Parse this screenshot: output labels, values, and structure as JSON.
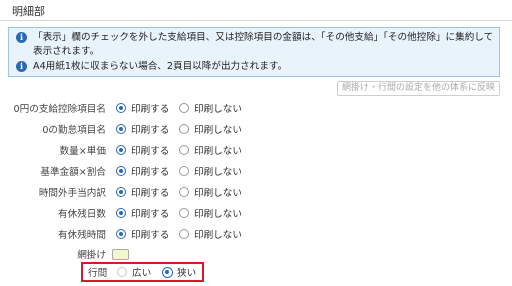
{
  "section": {
    "title": "明細部"
  },
  "info": {
    "line1": "「表示」欄のチェックを外した支給項目、又は控除項目の金額は、「その他支給」「その他控除」に集約して表示されます。",
    "line2": "A4用紙1枚に収まらない場合、2頁目以降が出力されます。",
    "icon": "info-icon"
  },
  "reflect_button": {
    "label": "網掛け・行間の設定を他の体系に反映"
  },
  "options": {
    "print": "印刷する",
    "no_print": "印刷しない"
  },
  "rows": [
    {
      "label": "0円の支給控除項目名",
      "selected": "print"
    },
    {
      "label": "0の勤怠項目名",
      "selected": "print"
    },
    {
      "label": "数量×単価",
      "selected": "print"
    },
    {
      "label": "基準金額×割合",
      "selected": "print"
    },
    {
      "label": "時間外手当内訳",
      "selected": "print"
    },
    {
      "label": "有休残日数",
      "selected": "print"
    },
    {
      "label": "有休残時間",
      "selected": "print"
    }
  ],
  "shading": {
    "label": "網掛け",
    "color": "#f3f8cc"
  },
  "spacing": {
    "label": "行間",
    "wide": "広い",
    "narrow": "狭い",
    "selected": "narrow"
  },
  "colors": {
    "accent": "#2a6ab4",
    "info_bg": "#e9f3fb",
    "highlight_border": "#d8192a"
  }
}
